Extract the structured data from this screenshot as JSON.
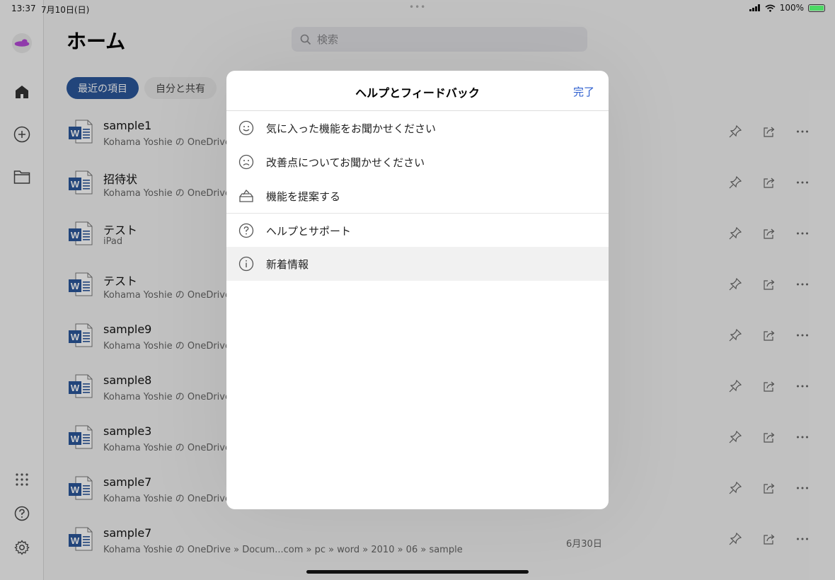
{
  "status_bar": {
    "time": "13:37",
    "date": "7月10日(日)",
    "battery": "100%"
  },
  "header": {
    "title": "ホーム",
    "search_placeholder": "検索"
  },
  "chips": [
    {
      "label": "最近の項目",
      "active": true
    },
    {
      "label": "自分と共有",
      "active": false
    }
  ],
  "files": [
    {
      "name": "sample1",
      "path": "Kohama Yoshie の OneDrive »",
      "date": ""
    },
    {
      "name": "招待状",
      "path": "Kohama Yoshie の OneDrive »",
      "date": ""
    },
    {
      "name": "テスト",
      "path": "iPad",
      "date": ""
    },
    {
      "name": "テスト",
      "path": "Kohama Yoshie の OneDrive »",
      "date": ""
    },
    {
      "name": "sample9",
      "path": "Kohama Yoshie の OneDrive »",
      "date": ""
    },
    {
      "name": "sample8",
      "path": "Kohama Yoshie の OneDrive »",
      "date": ""
    },
    {
      "name": "sample3",
      "path": "Kohama Yoshie の OneDrive »",
      "date": ""
    },
    {
      "name": "sample7",
      "path": "Kohama Yoshie の OneDrive »",
      "date": ""
    },
    {
      "name": "sample7",
      "path": "Kohama Yoshie の OneDrive » Docum...com » pc » word » 2010 » 06 » sample",
      "date": "6月30日"
    }
  ],
  "modal": {
    "title": "ヘルプとフィードバック",
    "done_label": "完了",
    "items": [
      {
        "icon": "smile-icon",
        "label": "気に入った機能をお聞かせください"
      },
      {
        "icon": "frown-icon",
        "label": "改善点についてお聞かせください"
      },
      {
        "icon": "suggestion-box-icon",
        "label": "機能を提案する"
      },
      {
        "icon": "question-circle-icon",
        "label": "ヘルプとサポート"
      },
      {
        "icon": "info-circle-icon",
        "label": "新着情報"
      }
    ]
  },
  "colors": {
    "accent": "#2b579a",
    "link": "#2b5dcf",
    "word_blue": "#2b579a"
  }
}
